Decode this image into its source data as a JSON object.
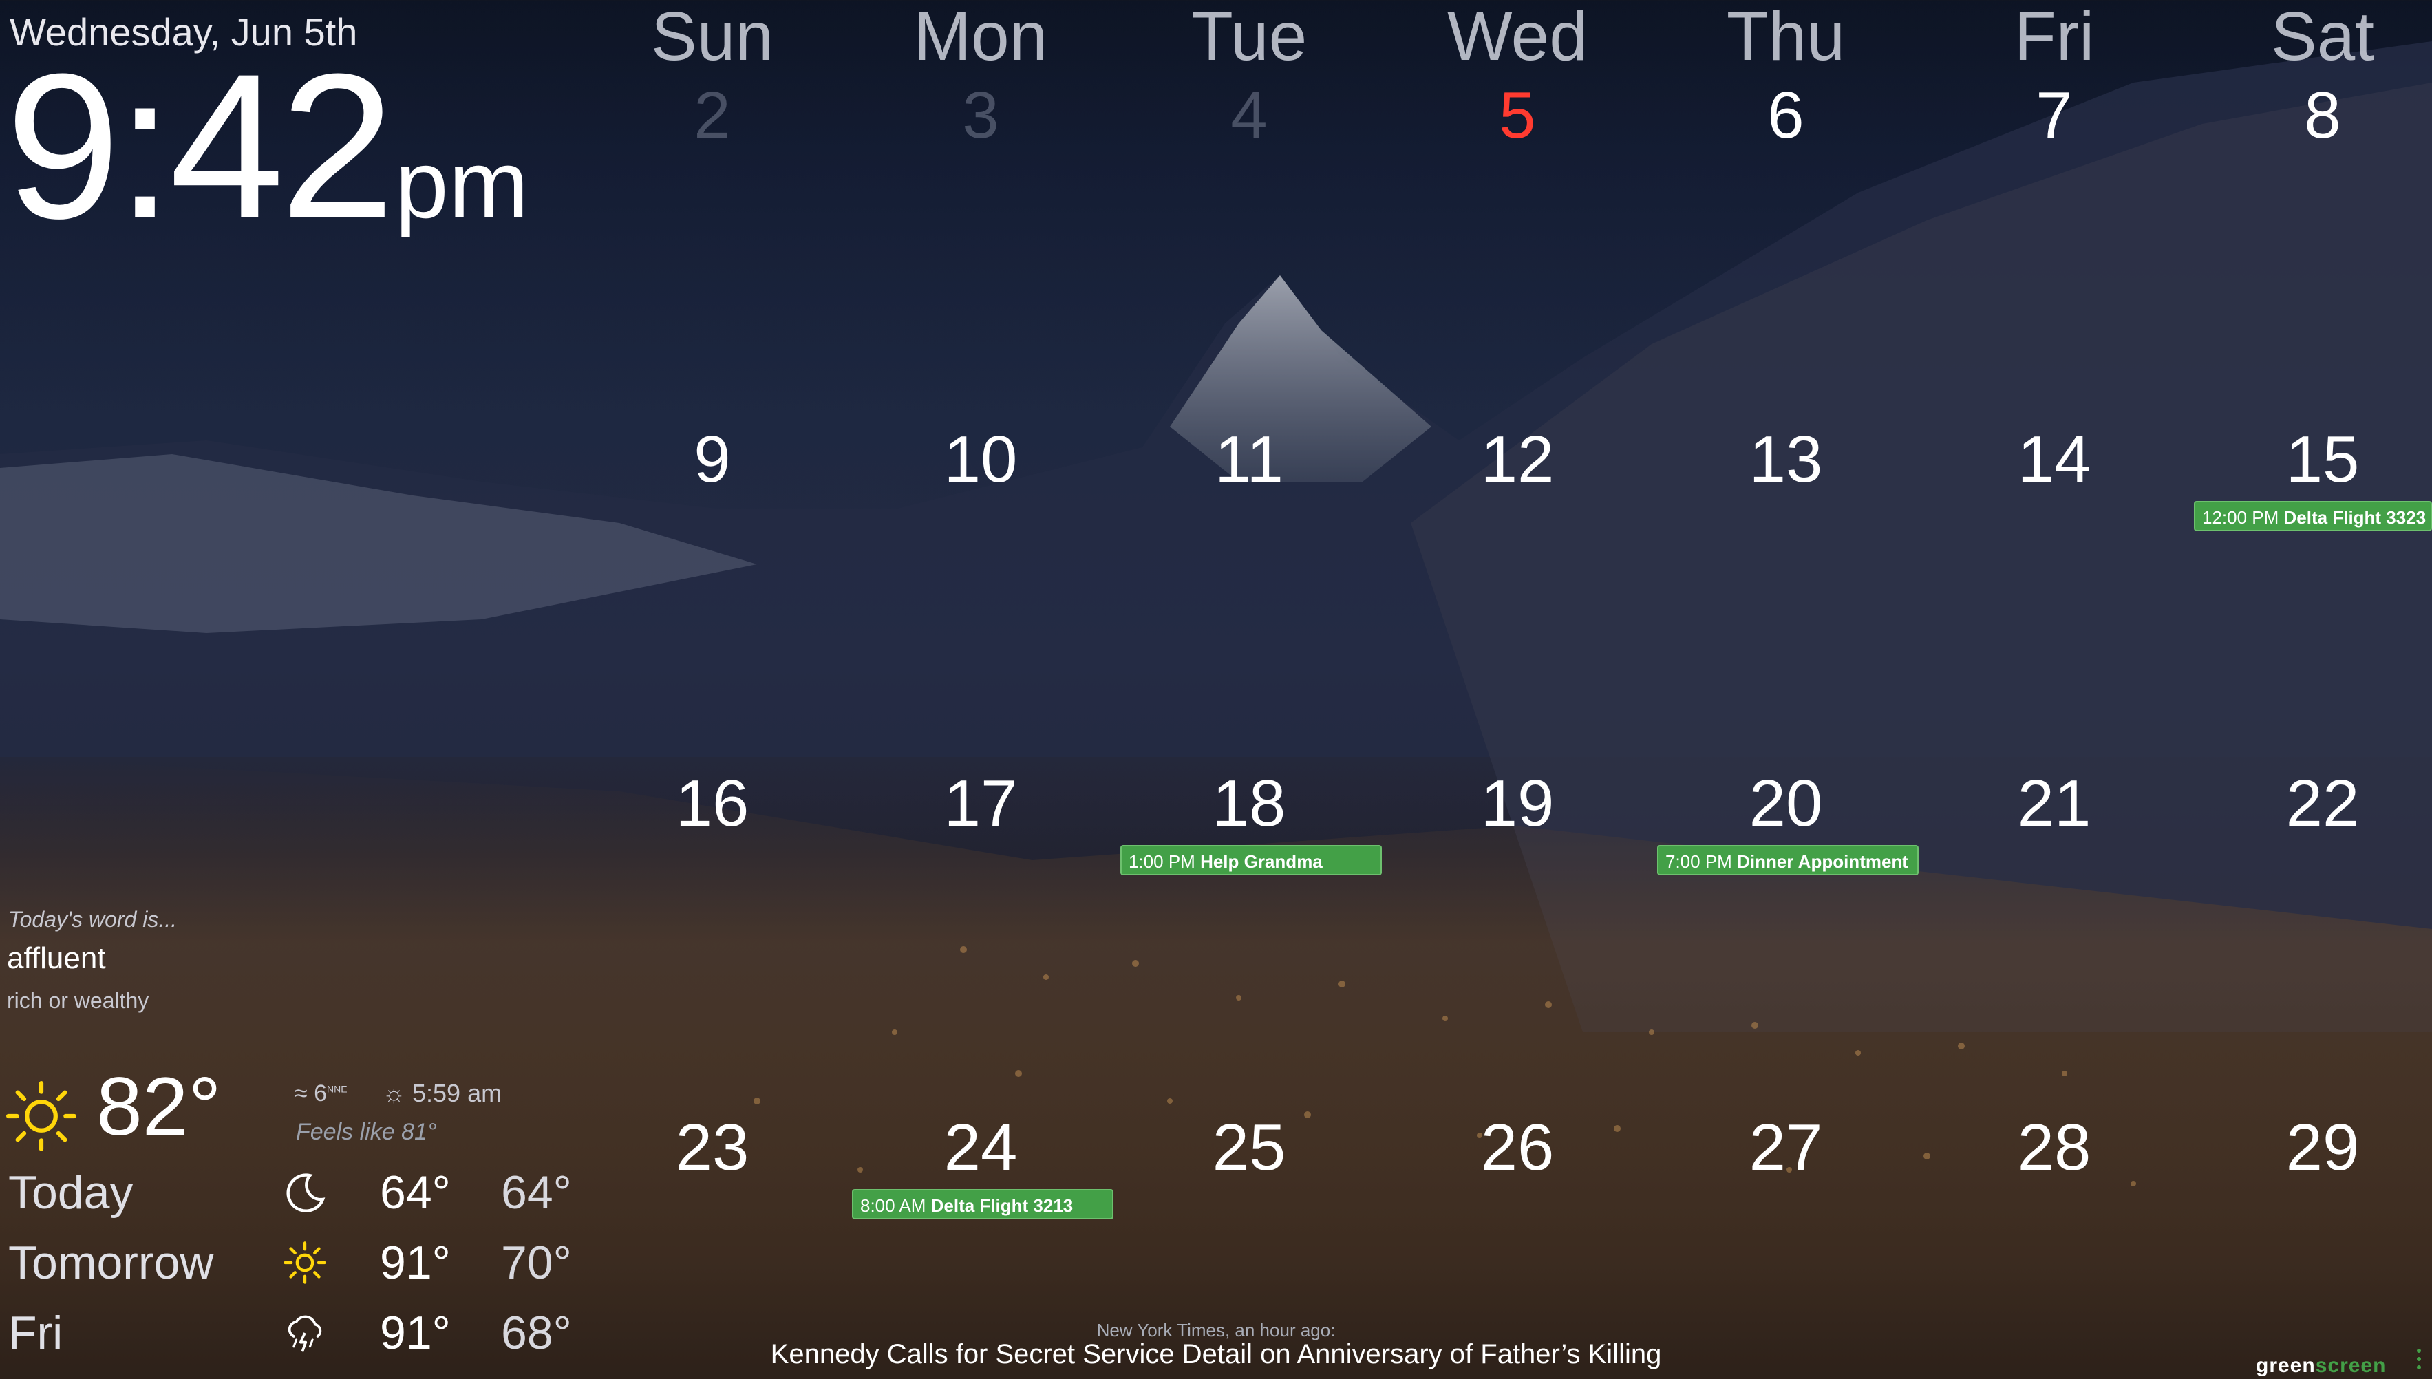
{
  "header": {
    "date": "Wednesday, Jun 5th",
    "time": "9:42",
    "ampm": "pm"
  },
  "calendar": {
    "days_of_week": [
      "Sun",
      "Mon",
      "Tue",
      "Wed",
      "Thu",
      "Fri",
      "Sat"
    ],
    "weeks": [
      [
        "2",
        "3",
        "4",
        "5",
        "6",
        "7",
        "8"
      ],
      [
        "9",
        "10",
        "11",
        "12",
        "13",
        "14",
        "15"
      ],
      [
        "16",
        "17",
        "18",
        "19",
        "20",
        "21",
        "22"
      ],
      [
        "23",
        "24",
        "25",
        "26",
        "27",
        "28",
        "29"
      ]
    ],
    "today": "5",
    "events": [
      {
        "day": "15",
        "time": "12:00 PM",
        "title": "Delta Flight 3323"
      },
      {
        "day": "18",
        "time": "1:00 PM",
        "title": "Help Grandma"
      },
      {
        "day": "20",
        "time": "7:00 PM",
        "title": "Dinner Appointment"
      },
      {
        "day": "24",
        "time": "8:00 AM",
        "title": "Delta Flight 3213"
      }
    ],
    "event_color": "#43a047",
    "today_color": "#ff3b30"
  },
  "word_of_day": {
    "intro": "Today's word is...",
    "word": "affluent",
    "definition": "rich or wealthy"
  },
  "weather": {
    "current_temp": "82°",
    "current_icon": "sun-icon",
    "wind": "6",
    "wind_dir": "NNE",
    "sunrise": "5:59 am",
    "feels_like": "Feels like 81°",
    "forecast": [
      {
        "label": "Today",
        "icon": "moon-icon",
        "high": "64°",
        "low": "64°"
      },
      {
        "label": "Tomorrow",
        "icon": "sun-icon",
        "high": "91°",
        "low": "70°"
      },
      {
        "label": "Fri",
        "icon": "thunderstorm-icon",
        "high": "91°",
        "low": "68°"
      }
    ],
    "sun_color": "#ffd60a"
  },
  "news": {
    "source": "New York Times, an hour ago:",
    "headline": "Kennedy Calls for Secret Service Detail on Anniversary of Father’s Killing"
  },
  "brand": {
    "part1": "green",
    "part2": "screen"
  }
}
